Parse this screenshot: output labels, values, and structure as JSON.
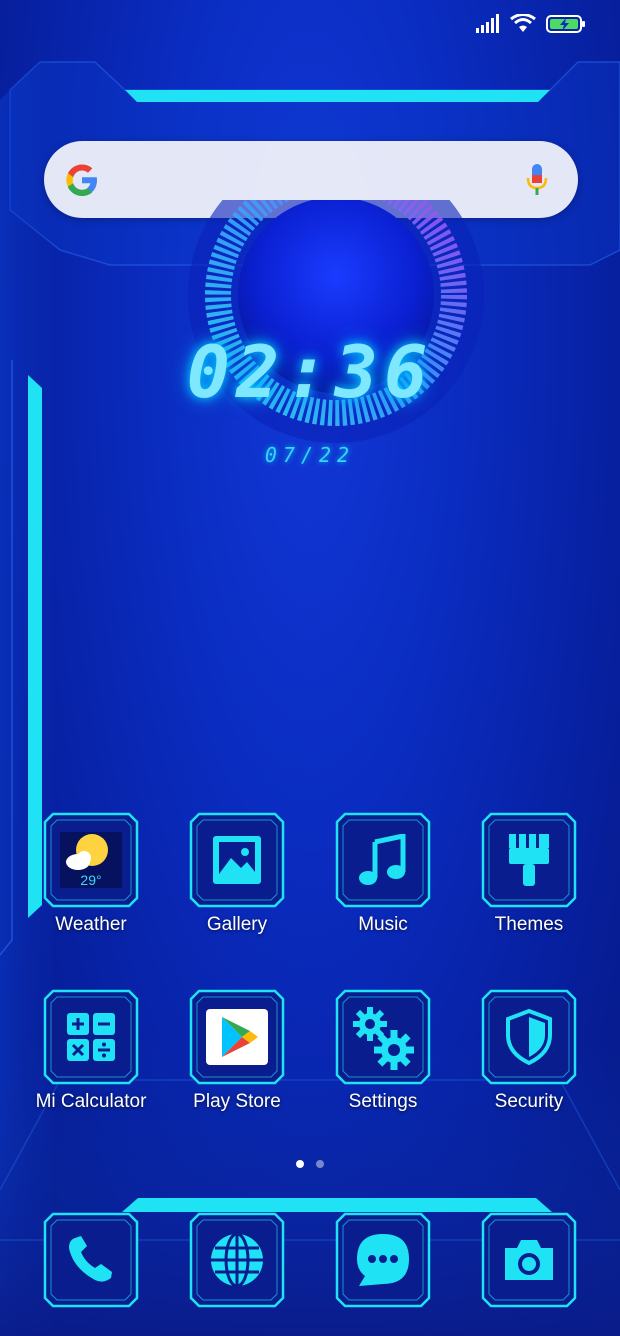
{
  "status_bar": {
    "icons": [
      "signal-icon",
      "wifi-icon",
      "battery-charging-icon"
    ]
  },
  "search": {
    "placeholder": "",
    "left_icon": "google-g-icon",
    "right_icon": "microphone-icon"
  },
  "clock": {
    "time": "02:36",
    "date": "07/22"
  },
  "apps_row1": [
    {
      "name": "weather",
      "label": "Weather",
      "icon": "weather-icon",
      "temp": "29°"
    },
    {
      "name": "gallery",
      "label": "Gallery",
      "icon": "gallery-icon"
    },
    {
      "name": "music",
      "label": "Music",
      "icon": "music-note-icon"
    },
    {
      "name": "themes",
      "label": "Themes",
      "icon": "paintbrush-icon"
    }
  ],
  "apps_row2": [
    {
      "name": "mi-calculator",
      "label": "Mi Calculator",
      "icon": "calculator-icon"
    },
    {
      "name": "play-store",
      "label": "Play Store",
      "icon": "play-store-icon"
    },
    {
      "name": "settings",
      "label": "Settings",
      "icon": "gears-icon"
    },
    {
      "name": "security",
      "label": "Security",
      "icon": "shield-icon"
    }
  ],
  "dock": [
    {
      "name": "phone",
      "icon": "phone-icon"
    },
    {
      "name": "browser",
      "icon": "globe-icon"
    },
    {
      "name": "messaging",
      "icon": "chat-bubble-icon"
    },
    {
      "name": "camera",
      "icon": "camera-icon"
    }
  ],
  "pages": {
    "count": 2,
    "active": 0
  },
  "colors": {
    "accent": "#1fe3f5",
    "background": "#0a2cc0",
    "label": "#ffffff"
  }
}
